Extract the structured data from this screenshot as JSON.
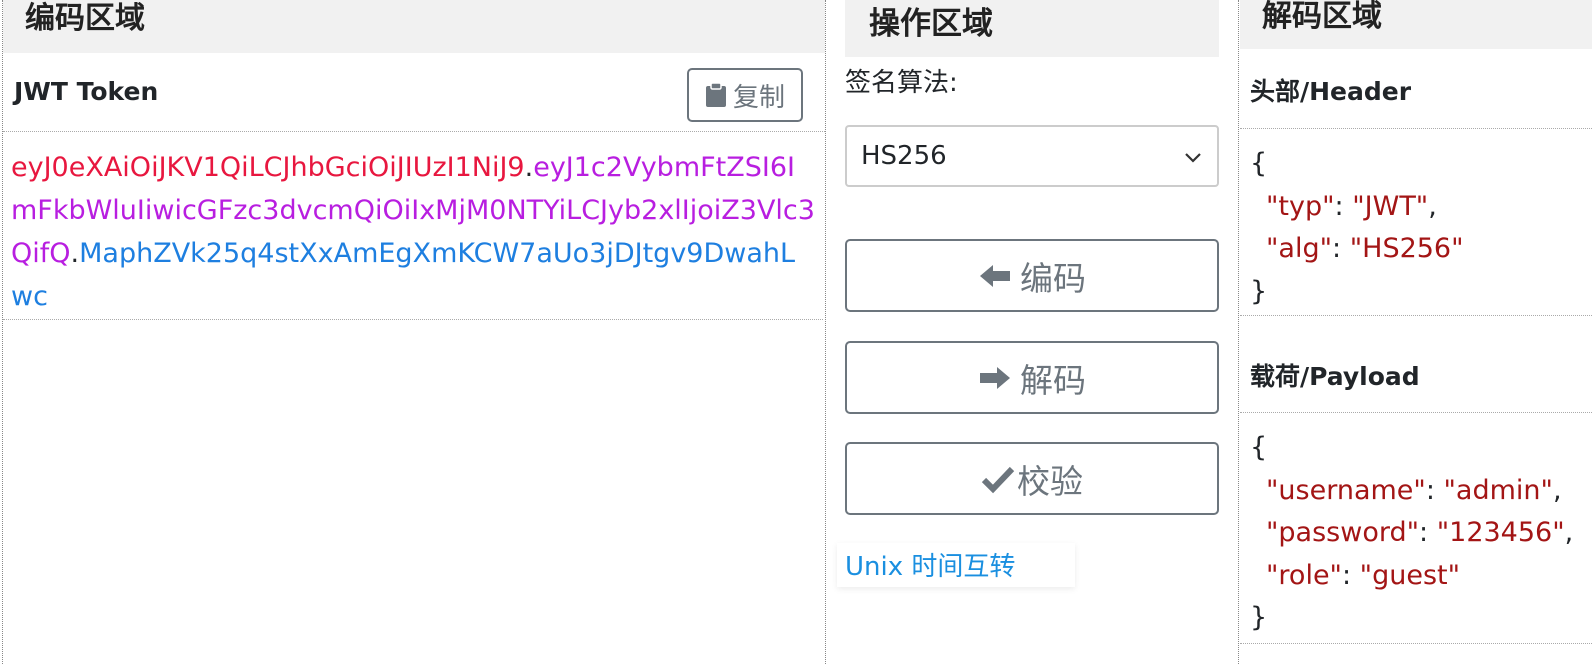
{
  "encode": {
    "title": "编码区域",
    "token_label": "JWT Token",
    "copy_label": "复制",
    "copy_icon": "clipboard-icon",
    "token": {
      "header": "eyJ0eXAiOiJKV1QiLCJhbGciOiJIUzI1NiJ9",
      "payload": "eyJ1c2VybmFtZSI6ImFkbWluIiwicGFzc3dvcmQiOiIxMjM0NTYiLCJyb2xlIjoiZ3Vlc3QifQ",
      "signature": "MaphZVk25q4stXxAmEgXmKCW7aUo3jDJtgv9DwahLwc",
      "separator": "."
    },
    "colors": {
      "header": "#e8173f",
      "payload": "#b81ee0",
      "signature": "#1e7fe0"
    }
  },
  "operate": {
    "title": "操作区域",
    "algo_label": "签名算法:",
    "algo_selected": "HS256",
    "encode_label": "编码",
    "decode_label": "解码",
    "verify_label": "校验",
    "unix_link": "Unix 时间互转"
  },
  "decode": {
    "title": "解码区域",
    "header_label": "头部/Header",
    "payload_label": "载荷/Payload",
    "header_json": [
      {
        "key": "typ",
        "value": "JWT",
        "comma": ","
      },
      {
        "key": "alg",
        "value": "HS256",
        "comma": ""
      }
    ],
    "payload_json": [
      {
        "key": "username",
        "value": "admin",
        "comma": ","
      },
      {
        "key": "password",
        "value": "123456",
        "comma": ","
      },
      {
        "key": "role",
        "value": "guest",
        "comma": ""
      }
    ],
    "brace_open": "{",
    "brace_close": "}",
    "colon": ": ",
    "quote": "\""
  }
}
